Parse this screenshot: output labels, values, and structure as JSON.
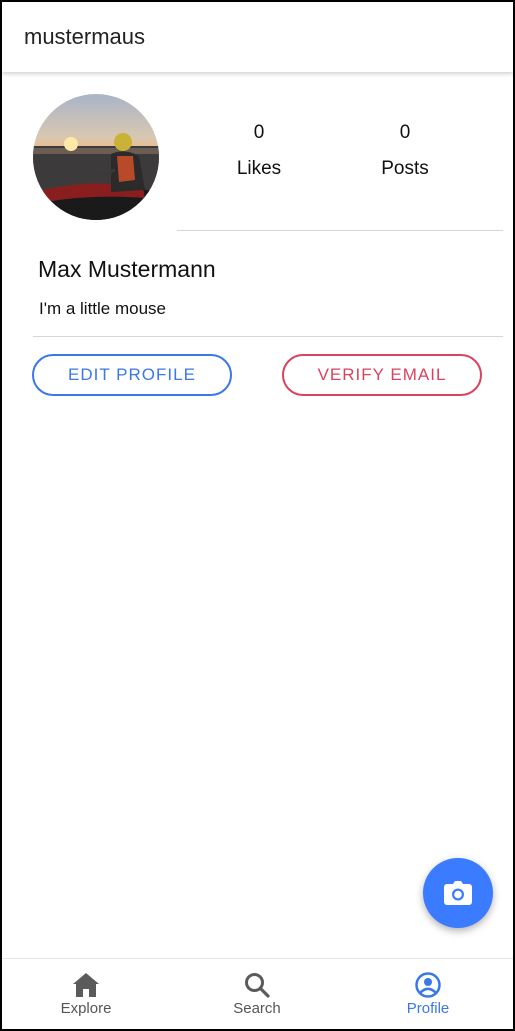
{
  "appbar": {
    "title": "mustermaus"
  },
  "profile": {
    "avatar_alt": "profile picture",
    "stats": {
      "likes_count": "0",
      "likes_label": "Likes",
      "posts_count": "0",
      "posts_label": "Posts"
    },
    "display_name": "Max Mustermann",
    "bio": "I'm a little mouse"
  },
  "actions": {
    "edit_label": "EDIT PROFILE",
    "verify_label": "VERIFY EMAIL"
  },
  "fab": {
    "icon": "camera-icon"
  },
  "bottom_nav": {
    "active": "profile",
    "items": [
      {
        "icon": "home-icon",
        "label": "Explore"
      },
      {
        "icon": "search-icon",
        "label": "Search"
      },
      {
        "icon": "account-circle-icon",
        "label": "Profile"
      }
    ]
  },
  "colors": {
    "primary": "#3b78e7",
    "danger": "#d9435f",
    "fab": "#3a7bff",
    "nav_inactive": "#555555"
  }
}
